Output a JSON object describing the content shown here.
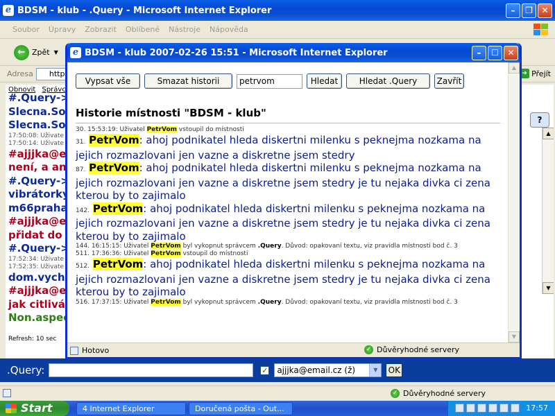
{
  "outer_window": {
    "title": "BDSM - klub - .Query - Microsoft Internet Explorer",
    "menu": [
      "Soubor",
      "Úpravy",
      "Zobrazit",
      "Oblíbené",
      "Nástroje",
      "Nápověda"
    ],
    "back_label": "Zpět",
    "address_label": "Adresa",
    "address_value": "http",
    "go_label": "Přejít",
    "top_links": [
      "Obnovit",
      "Správc"
    ],
    "chat_lines": [
      {
        "text": "#.Query->a",
        "color": "blue"
      },
      {
        "text": "Slecna.Sou",
        "color": "blue"
      },
      {
        "text": "Slecna.Sou",
        "color": "blue"
      },
      {
        "text": "17:50:08: Uživate",
        "color": "small"
      },
      {
        "text": "17:50:14: Uživate",
        "color": "small"
      },
      {
        "text": "#ajjjka@em",
        "color": "red"
      },
      {
        "text": "není, a ani",
        "color": "red"
      },
      {
        "text": "#.Query->a",
        "color": "blue"
      },
      {
        "text": "vibrátorky",
        "color": "blue"
      },
      {
        "text": "m66praha:",
        "color": "blue"
      },
      {
        "text": "#ajjjka@em",
        "color": "red"
      },
      {
        "text": "přidat do n",
        "color": "red"
      },
      {
        "text": "#.Query->a",
        "color": "blue"
      },
      {
        "text": "17:52:34: Uživate",
        "color": "small"
      },
      {
        "text": "17:52:35: Uživate",
        "color": "small"
      },
      {
        "text": "dom.vycho",
        "color": "blue"
      },
      {
        "text": "#ajjjka@em",
        "color": "red"
      },
      {
        "text": "jak citlivá js",
        "color": "red"
      },
      {
        "text": "Non.aspec",
        "color": "green"
      }
    ],
    "refresh": "Refresh: 10 sec",
    "help_label": "?",
    "query_label": ".Query:",
    "query_input": "",
    "query_checked": true,
    "recipient_select": "ajjjka@email.cz (ž)",
    "ok_label": "OK",
    "status_trust": "Důvěryhodné servery"
  },
  "popup": {
    "title": "BDSM - klub 2007-02-26 15:51 - Microsoft Internet Explorer",
    "buttons": {
      "list_all": "Vypsat vše",
      "delete_history": "Smazat historii",
      "search": "Hledat",
      "search_query": "Hledat .Query",
      "close": "Zavřít"
    },
    "search_value": "petrvom",
    "heading": "Historie místnosti \"BDSM - klub\"",
    "entries": [
      {
        "type": "sys",
        "pre": "30. 15:53:19: Uživatel ",
        "nick": "PetrVom",
        "post": " vstoupil do místnosti"
      },
      {
        "type": "msg",
        "num": "31.",
        "nick": "PetrVom",
        "text": ": ahoj podnikatel hleda diskertni milenku s peknejma nozkama na jejich rozmazlovani jen vazne a diskretne jsem stedry"
      },
      {
        "type": "msg",
        "num": "87.",
        "nick": "PetrVom",
        "text": ": ahoj podnikatel hleda diskertni milenku s peknejma nozkama na jejich rozmazlovani jen vazne a diskretne jsem stedry je tu nejaka divka ci zena kterou by to zajimalo"
      },
      {
        "type": "msg",
        "num": "142.",
        "nick": "PetrVom",
        "text": ": ahoj podnikatel hleda diskertni milenku s peknejma nozkama na jejich rozmazlovani jen vazne a diskretne jsem stedry je tu nejaka divka ci zena kterou by to zajimalo"
      },
      {
        "type": "sys",
        "pre": "144. 16:15:15: Uživatel ",
        "nick": "PetrVom",
        "post": " byl vykopnut správcem ",
        "bold": ".Query",
        "post2": ". Důvod: opakovaní textu, viz pravidla místnosti bod č. 3"
      },
      {
        "type": "sys",
        "pre": "511. 17:36:36: Uživatel ",
        "nick": "PetrVom",
        "post": " vstoupil do místnosti"
      },
      {
        "type": "msg",
        "num": "512.",
        "nick": "PetrVom",
        "text": ": ahoj podnikatel hleda diskertni milenku s peknejma nozkama na jejich rozmazlovani jen vazne a diskretne jsem stedry je tu nejaka divka ci zena kterou by to zajimalo"
      },
      {
        "type": "sys",
        "pre": "516. 17:37:15: Uživatel ",
        "nick": "PetrVom",
        "post": " byl vykopnut správcem ",
        "bold": ".Query",
        "post2": ". Důvod: opakovaní textu, viz pravidla místnosti bod č. 3"
      }
    ],
    "status_left": "Hotovo",
    "status_trust": "Důvěryhodné servery"
  },
  "taskbar": {
    "start": "Start",
    "tasks": [
      "4 Internet Explorer",
      "Doručená pošta - Out..."
    ],
    "clock": "17:57"
  },
  "icons": {
    "ie": "ie-logo-icon",
    "back": "back-arrow-icon",
    "ok": "check-shield-icon"
  }
}
